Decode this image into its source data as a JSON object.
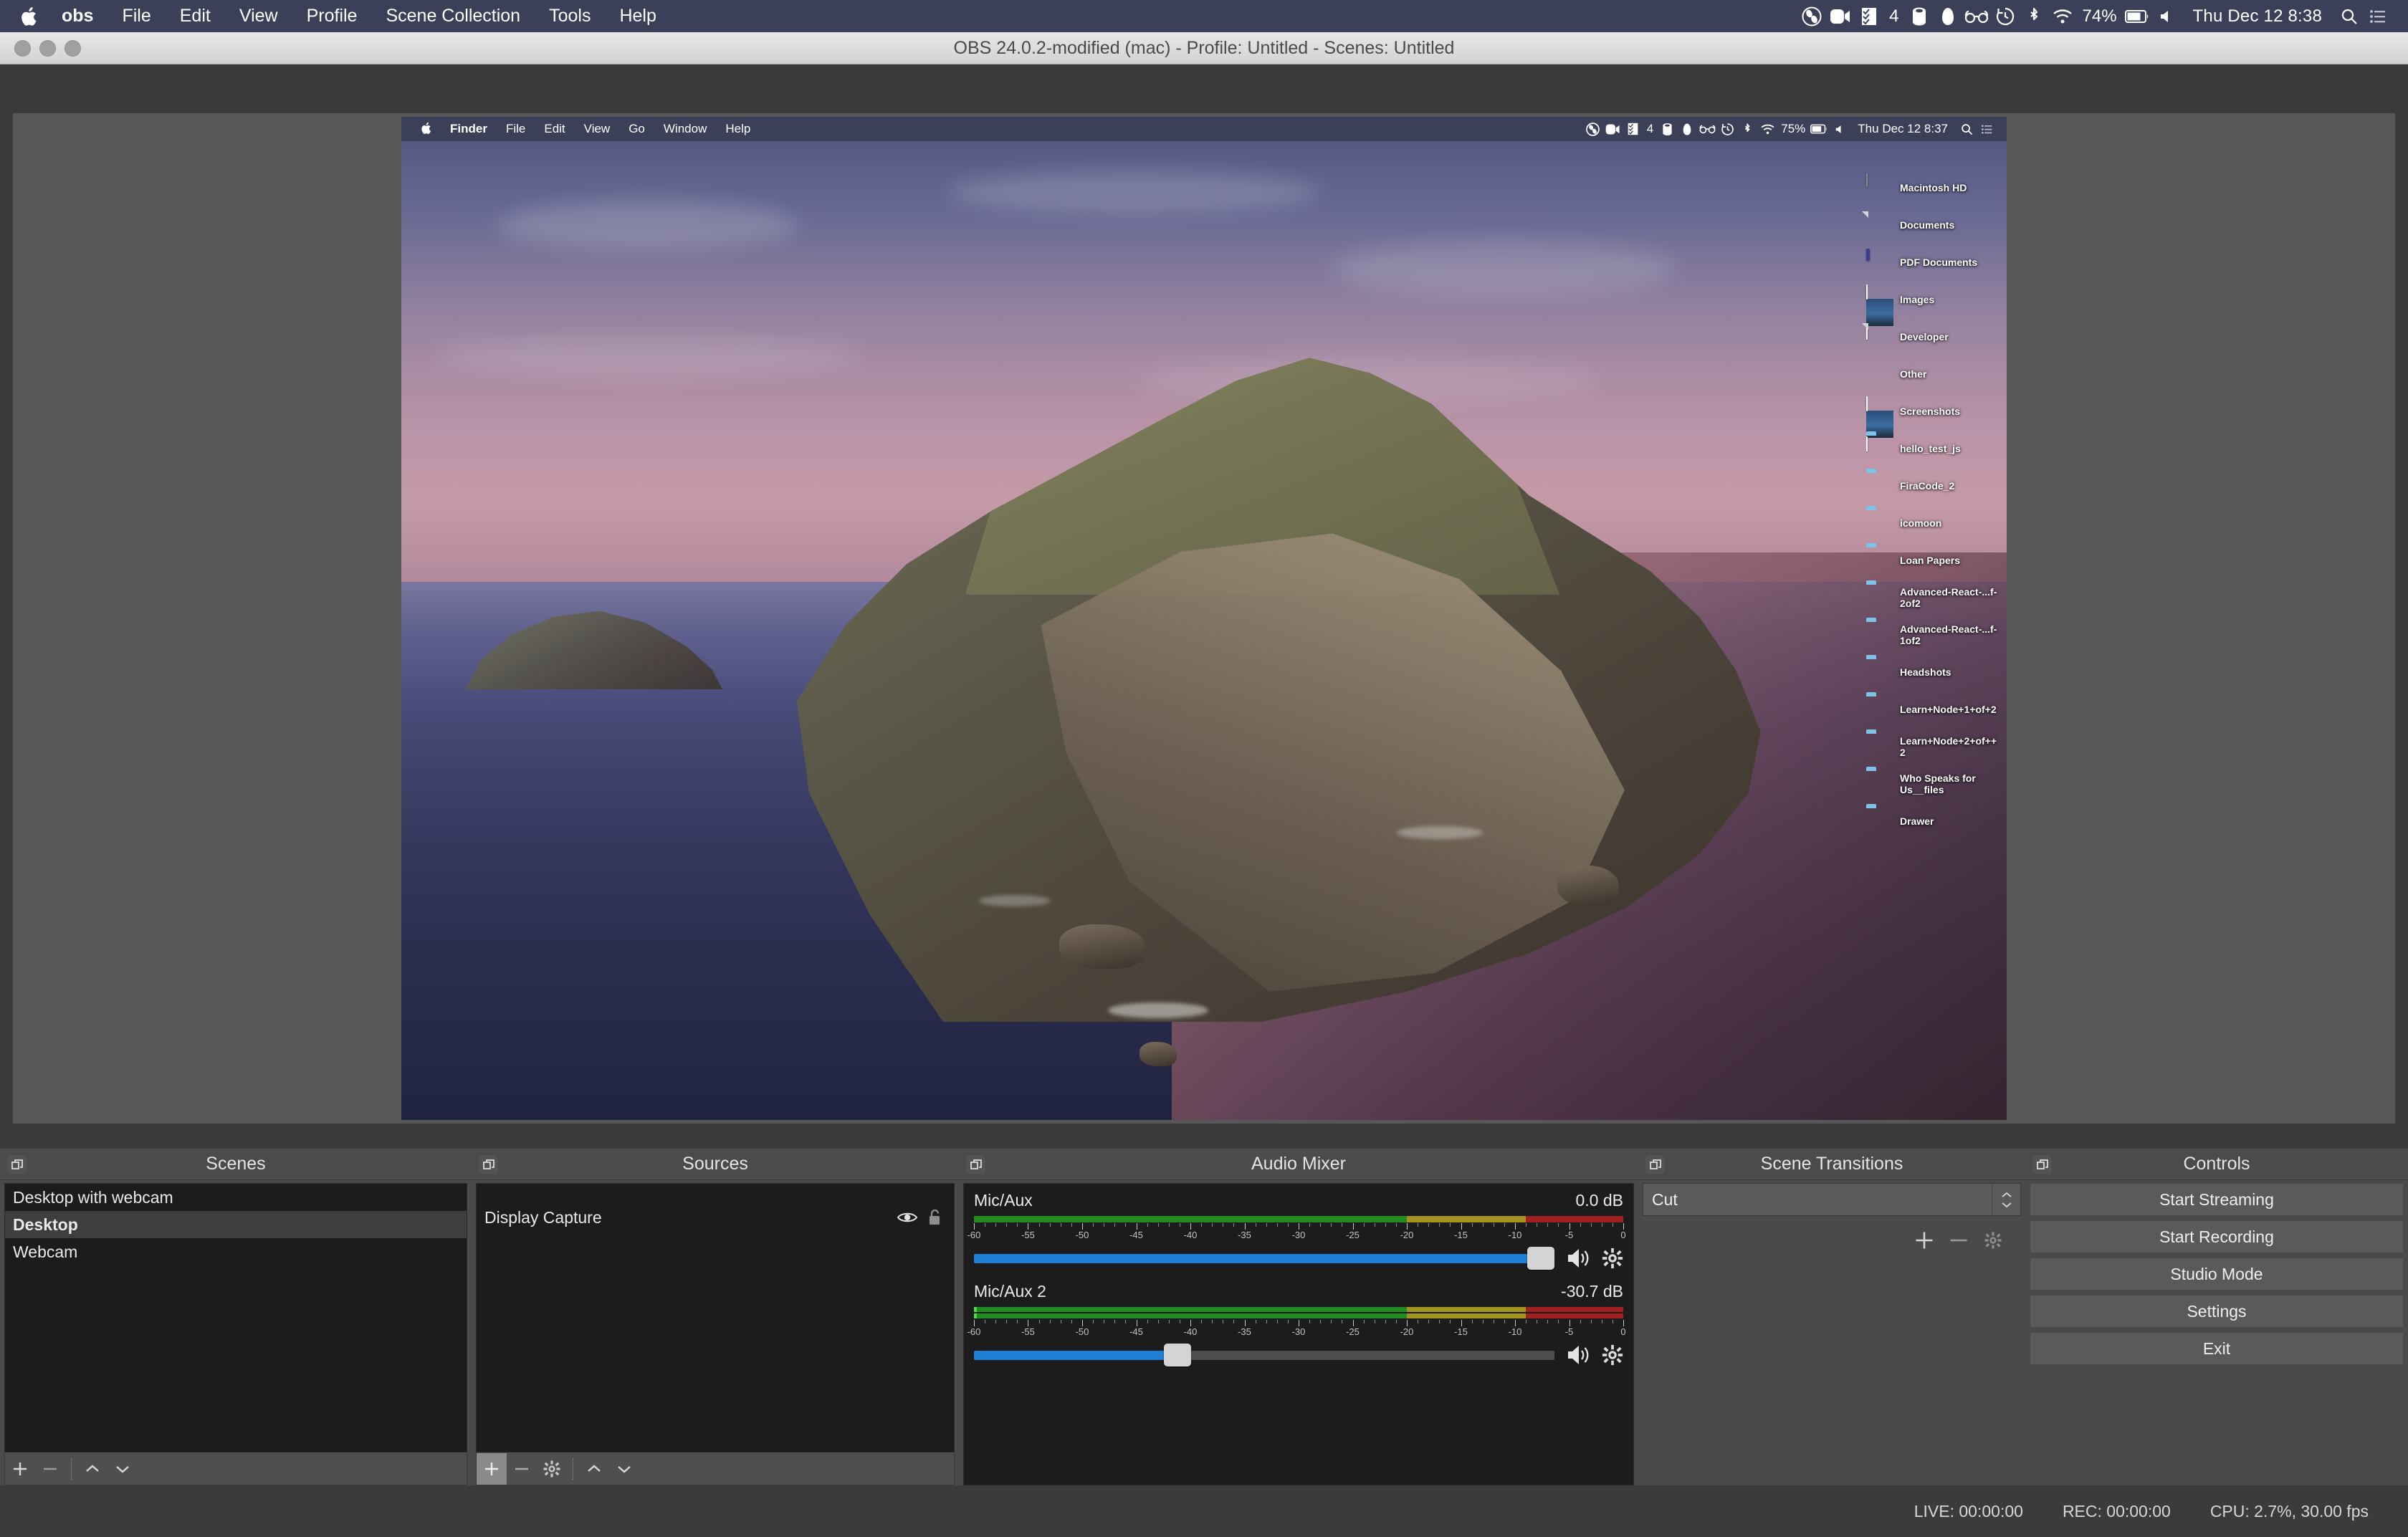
{
  "mac_menubar": {
    "apple_icon": "apple-logo-icon",
    "items": [
      {
        "label": "obs",
        "bold": true
      },
      {
        "label": "File",
        "bold": false
      },
      {
        "label": "Edit",
        "bold": false
      },
      {
        "label": "View",
        "bold": false
      },
      {
        "label": "Profile",
        "bold": false
      },
      {
        "label": "Scene Collection",
        "bold": false
      },
      {
        "label": "Tools",
        "bold": false
      },
      {
        "label": "Help",
        "bold": false
      }
    ],
    "status_icons": [
      "obs-icon",
      "camera-icon",
      "checklist-icon",
      "cylinder-icon",
      "dropbox-icon",
      "glasses-icon",
      "timemachine-icon",
      "bluetooth-icon",
      "wifi-icon"
    ],
    "checklist_count": "4",
    "battery_percent": "74%",
    "clock": "Thu Dec 12  8:38",
    "right_icons": [
      "search-icon",
      "control-center-icon"
    ]
  },
  "obs_window": {
    "title": "OBS 24.0.2-modified (mac) - Profile: Untitled - Scenes: Untitled"
  },
  "captured_screen": {
    "menubar": {
      "apple_icon": "apple-logo-icon",
      "items": [
        {
          "label": "Finder",
          "bold": true
        },
        {
          "label": "File",
          "bold": false
        },
        {
          "label": "Edit",
          "bold": false
        },
        {
          "label": "View",
          "bold": false
        },
        {
          "label": "Go",
          "bold": false
        },
        {
          "label": "Window",
          "bold": false
        },
        {
          "label": "Help",
          "bold": false
        }
      ],
      "battery_percent": "75%",
      "clock": "Thu Dec 12  8:37"
    },
    "desktop_icons": [
      {
        "label": "Macintosh HD",
        "kind": "harddisk"
      },
      {
        "label": "Documents",
        "kind": "document"
      },
      {
        "label": "PDF Documents",
        "kind": "pdf"
      },
      {
        "label": "Images",
        "kind": "photo"
      },
      {
        "label": "Developer",
        "kind": "document"
      },
      {
        "label": "Other",
        "kind": "box"
      },
      {
        "label": "Screenshots",
        "kind": "photo"
      },
      {
        "label": "hello_test_js",
        "kind": "folder"
      },
      {
        "label": "FiraCode_2",
        "kind": "folder"
      },
      {
        "label": "icomoon",
        "kind": "folder"
      },
      {
        "label": "Loan Papers",
        "kind": "folder"
      },
      {
        "label": "Advanced-React-...f-2of2",
        "kind": "folder"
      },
      {
        "label": "Advanced-React-...f-1of2",
        "kind": "folder"
      },
      {
        "label": "Headshots",
        "kind": "folder"
      },
      {
        "label": "Learn+Node+1+of+2",
        "kind": "folder"
      },
      {
        "label": "Learn+Node+2+of++2",
        "kind": "folder"
      },
      {
        "label": "Who Speaks for Us__files",
        "kind": "folder"
      },
      {
        "label": "Drawer",
        "kind": "folder"
      }
    ]
  },
  "scenes_dock": {
    "title": "Scenes",
    "items": [
      {
        "label": "Desktop with webcam",
        "selected": false
      },
      {
        "label": "Desktop",
        "selected": true
      },
      {
        "label": "Webcam",
        "selected": false
      }
    ],
    "toolbar": [
      "add-icon",
      "remove-icon",
      "move-up-icon",
      "move-down-icon"
    ]
  },
  "sources_dock": {
    "title": "Sources",
    "items": [
      {
        "label": "Display Capture",
        "visible": true,
        "locked": false
      }
    ],
    "toolbar": [
      "add-icon",
      "remove-icon",
      "properties-icon",
      "move-up-icon",
      "move-down-icon"
    ]
  },
  "audio_mixer": {
    "title": "Audio Mixer",
    "scale_labels": [
      "-60",
      "-55",
      "-50",
      "-45",
      "-40",
      "-35",
      "-30",
      "-25",
      "-20",
      "-15",
      "-10",
      "-5",
      "0"
    ],
    "sources": [
      {
        "name": "Mic/Aux",
        "db": "0.0 dB",
        "volume_percent": 100,
        "channels": 1,
        "peak_percent": 0,
        "mute_icon": "speaker-icon",
        "settings_icon": "gear-icon"
      },
      {
        "name": "Mic/Aux 2",
        "db": "-30.7 dB",
        "volume_percent": 35,
        "channels": 2,
        "peak_percent": 0.5,
        "mute_icon": "speaker-icon",
        "settings_icon": "gear-icon"
      }
    ]
  },
  "scene_transitions": {
    "title": "Scene Transitions",
    "selected": "Cut",
    "tools": [
      "add-icon",
      "remove-icon",
      "gear-icon"
    ]
  },
  "controls": {
    "title": "Controls",
    "buttons": [
      {
        "label": "Start Streaming"
      },
      {
        "label": "Start Recording"
      },
      {
        "label": "Studio Mode"
      },
      {
        "label": "Settings"
      },
      {
        "label": "Exit"
      }
    ]
  },
  "statusbar": {
    "live": "LIVE: 00:00:00",
    "rec": "REC: 00:00:00",
    "cpu": "CPU: 2.7%, 30.00 fps"
  },
  "colors": {
    "menubar_bg": "#3c3f58",
    "obs_bg": "#3b3b3b",
    "dock_bg": "#4a4a4a",
    "list_bg": "#1c1c1c",
    "slider_blue": "#1f7fd4",
    "meter_green": "#228B22",
    "meter_yellow": "#a39321",
    "meter_red": "#a01f1f"
  }
}
